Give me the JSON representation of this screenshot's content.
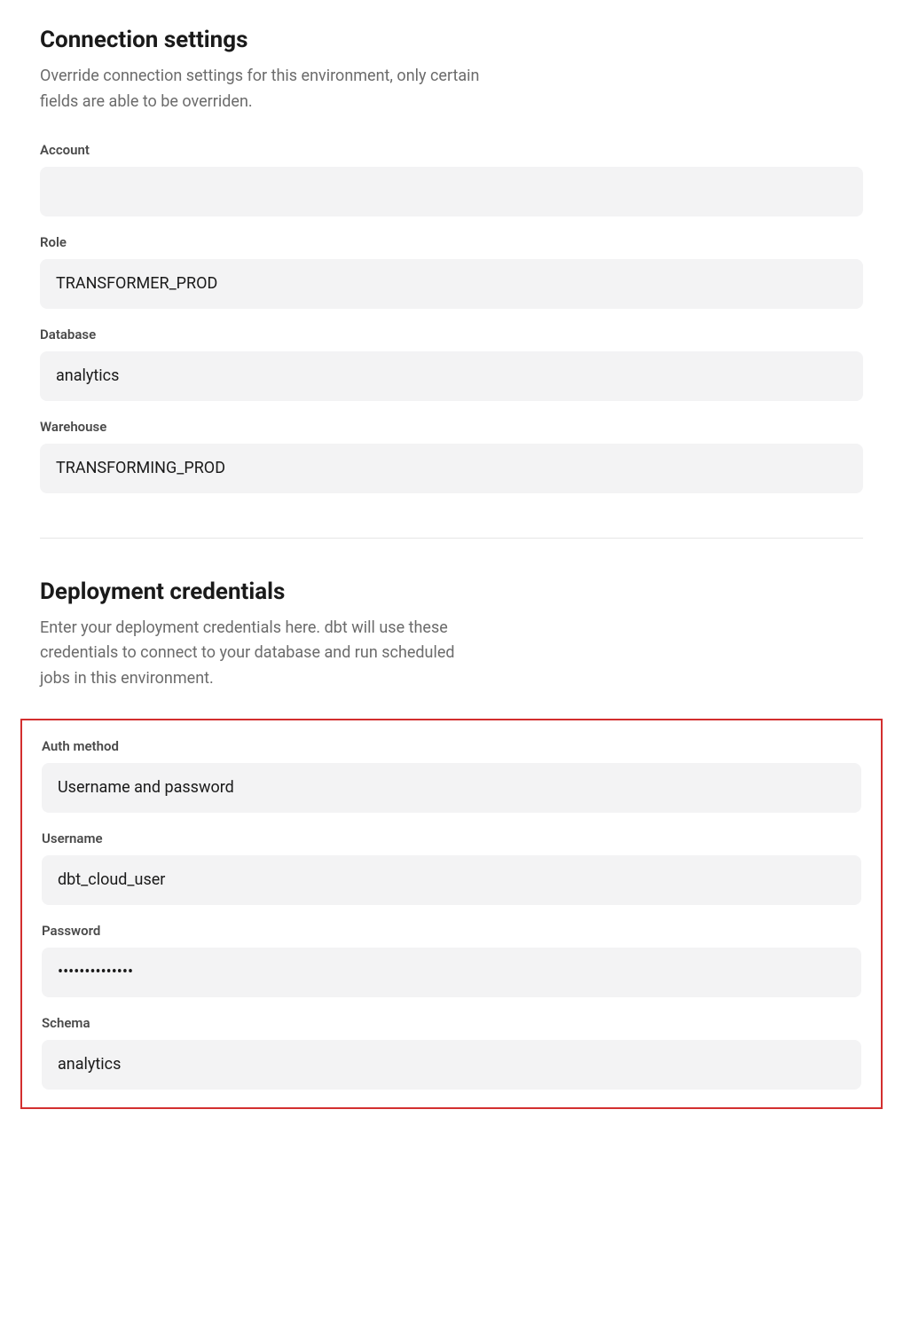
{
  "connection": {
    "title": "Connection settings",
    "description": "Override connection settings for this environment, only certain fields are able to be overriden.",
    "fields": {
      "account": {
        "label": "Account",
        "value": ""
      },
      "role": {
        "label": "Role",
        "value": "TRANSFORMER_PROD"
      },
      "database": {
        "label": "Database",
        "value": "analytics"
      },
      "warehouse": {
        "label": "Warehouse",
        "value": "TRANSFORMING_PROD"
      }
    }
  },
  "deployment": {
    "title": "Deployment credentials",
    "description": "Enter your deployment credentials here. dbt will use these credentials to connect to your database and run scheduled jobs in this environment.",
    "fields": {
      "auth_method": {
        "label": "Auth method",
        "value": "Username and password"
      },
      "username": {
        "label": "Username",
        "value": "dbt_cloud_user"
      },
      "password": {
        "label": "Password",
        "value": "••••••••••••••"
      },
      "schema": {
        "label": "Schema",
        "value": "analytics"
      }
    }
  }
}
